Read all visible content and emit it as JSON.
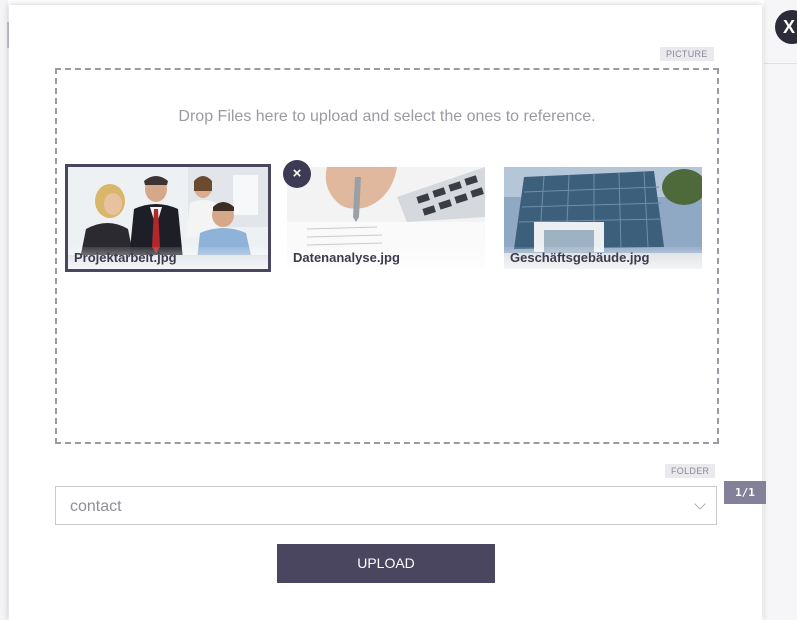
{
  "close_button": "X",
  "picture_label": "PICTURE",
  "dropzone_text": "Drop Files here to upload and select the ones to reference.",
  "files": [
    {
      "name": "Projektarbeit.jpg",
      "selected": true
    },
    {
      "name": "Datenanalyse.jpg",
      "selected": false
    },
    {
      "name": "Geschäftsgebäude.jpg",
      "selected": false
    }
  ],
  "remove_button": "×",
  "pager": "1/1",
  "folder_label": "FOLDER",
  "folder_select": {
    "value": "contact"
  },
  "upload_button": "UPLOAD",
  "colors": {
    "accent": "#4a4660",
    "close_bg": "#2b2b39",
    "pager_bg": "#83819a"
  }
}
